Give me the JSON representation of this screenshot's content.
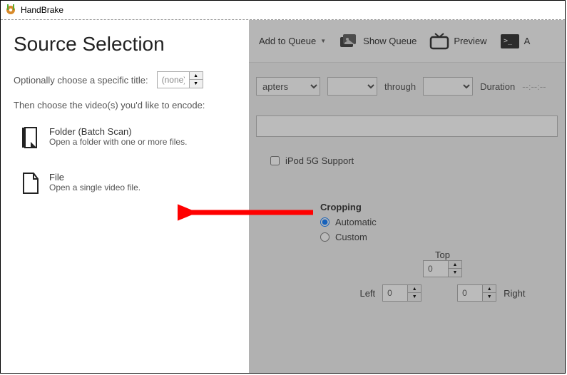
{
  "window": {
    "title": "HandBrake"
  },
  "sourcePanel": {
    "heading": "Source Selection",
    "optionalLabel": "Optionally choose a specific title:",
    "titleValue": "(none)",
    "thenLabel": "Then choose the video(s) you'd like to encode:",
    "folder": {
      "title": "Folder (Batch Scan)",
      "desc": "Open a folder with one or more files."
    },
    "file": {
      "title": "File",
      "desc": "Open a single video file."
    }
  },
  "toolbar": {
    "addQueue": "Add to Queue",
    "showQueue": "Show Queue",
    "preview": "Preview",
    "more": "A"
  },
  "sourceRow": {
    "dropLabel": "apters",
    "through": "through",
    "durationLabel": "Duration",
    "durationValue": "--:--:--"
  },
  "ipod": {
    "label": "iPod 5G Support"
  },
  "cropping": {
    "title": "Cropping",
    "auto": "Automatic",
    "custom": "Custom",
    "top": "Top",
    "left": "Left",
    "right": "Right",
    "topVal": "0",
    "leftVal": "0",
    "rightVal": "0"
  }
}
